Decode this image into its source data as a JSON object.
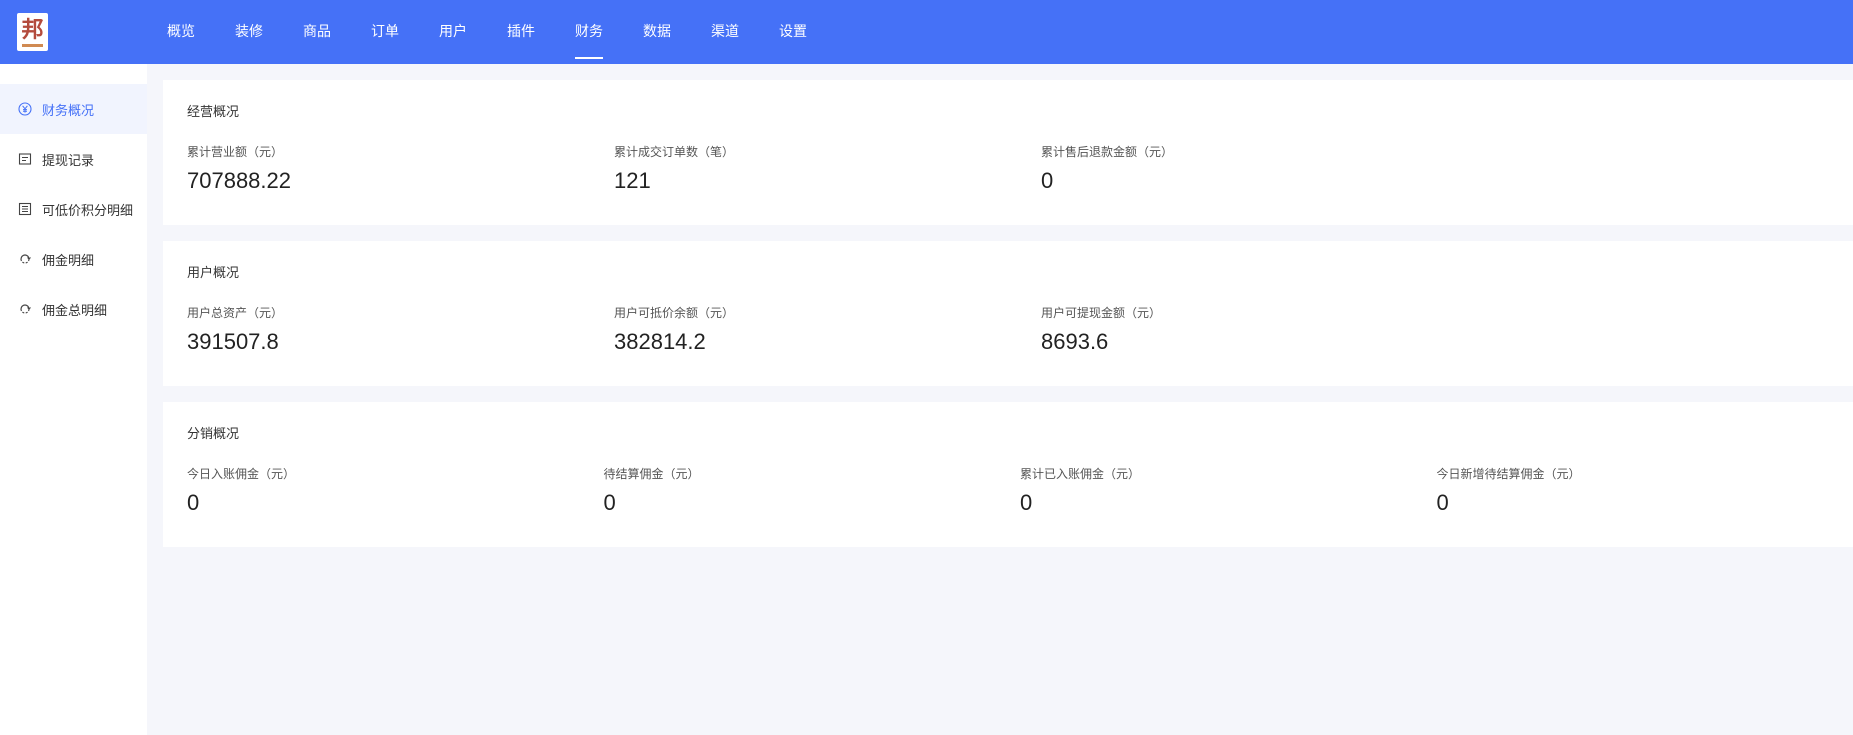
{
  "logo": {
    "text": "邦"
  },
  "nav": {
    "items": [
      "概览",
      "装修",
      "商品",
      "订单",
      "用户",
      "插件",
      "财务",
      "数据",
      "渠道",
      "设置"
    ],
    "active": "财务"
  },
  "sidebar": {
    "items": [
      {
        "label": "财务概况",
        "icon": "yen-circle-icon",
        "active": true
      },
      {
        "label": "提现记录",
        "icon": "record-icon",
        "active": false
      },
      {
        "label": "可低价积分明细",
        "icon": "list-detail-icon",
        "active": false
      },
      {
        "label": "佣金明细",
        "icon": "commission-icon",
        "active": false
      },
      {
        "label": "佣金总明细",
        "icon": "commission-total-icon",
        "active": false
      }
    ]
  },
  "cards": [
    {
      "title": "经营概况",
      "stats": [
        {
          "label": "累计营业额（元）",
          "value": "707888.22"
        },
        {
          "label": "累计成交订单数（笔）",
          "value": "121"
        },
        {
          "label": "累计售后退款金额（元）",
          "value": "0"
        }
      ]
    },
    {
      "title": "用户概况",
      "stats": [
        {
          "label": "用户总资产（元）",
          "value": "391507.8"
        },
        {
          "label": "用户可抵价余额（元）",
          "value": "382814.2"
        },
        {
          "label": "用户可提现金额（元）",
          "value": "8693.6"
        }
      ]
    },
    {
      "title": "分销概况",
      "stats": [
        {
          "label": "今日入账佣金（元）",
          "value": "0"
        },
        {
          "label": "待结算佣金（元）",
          "value": "0"
        },
        {
          "label": "累计已入账佣金（元）",
          "value": "0"
        },
        {
          "label": "今日新增待结算佣金（元）",
          "value": "0"
        }
      ]
    }
  ],
  "colors": {
    "primary": "#4571f7",
    "background": "#f5f6fb",
    "card": "#ffffff"
  }
}
